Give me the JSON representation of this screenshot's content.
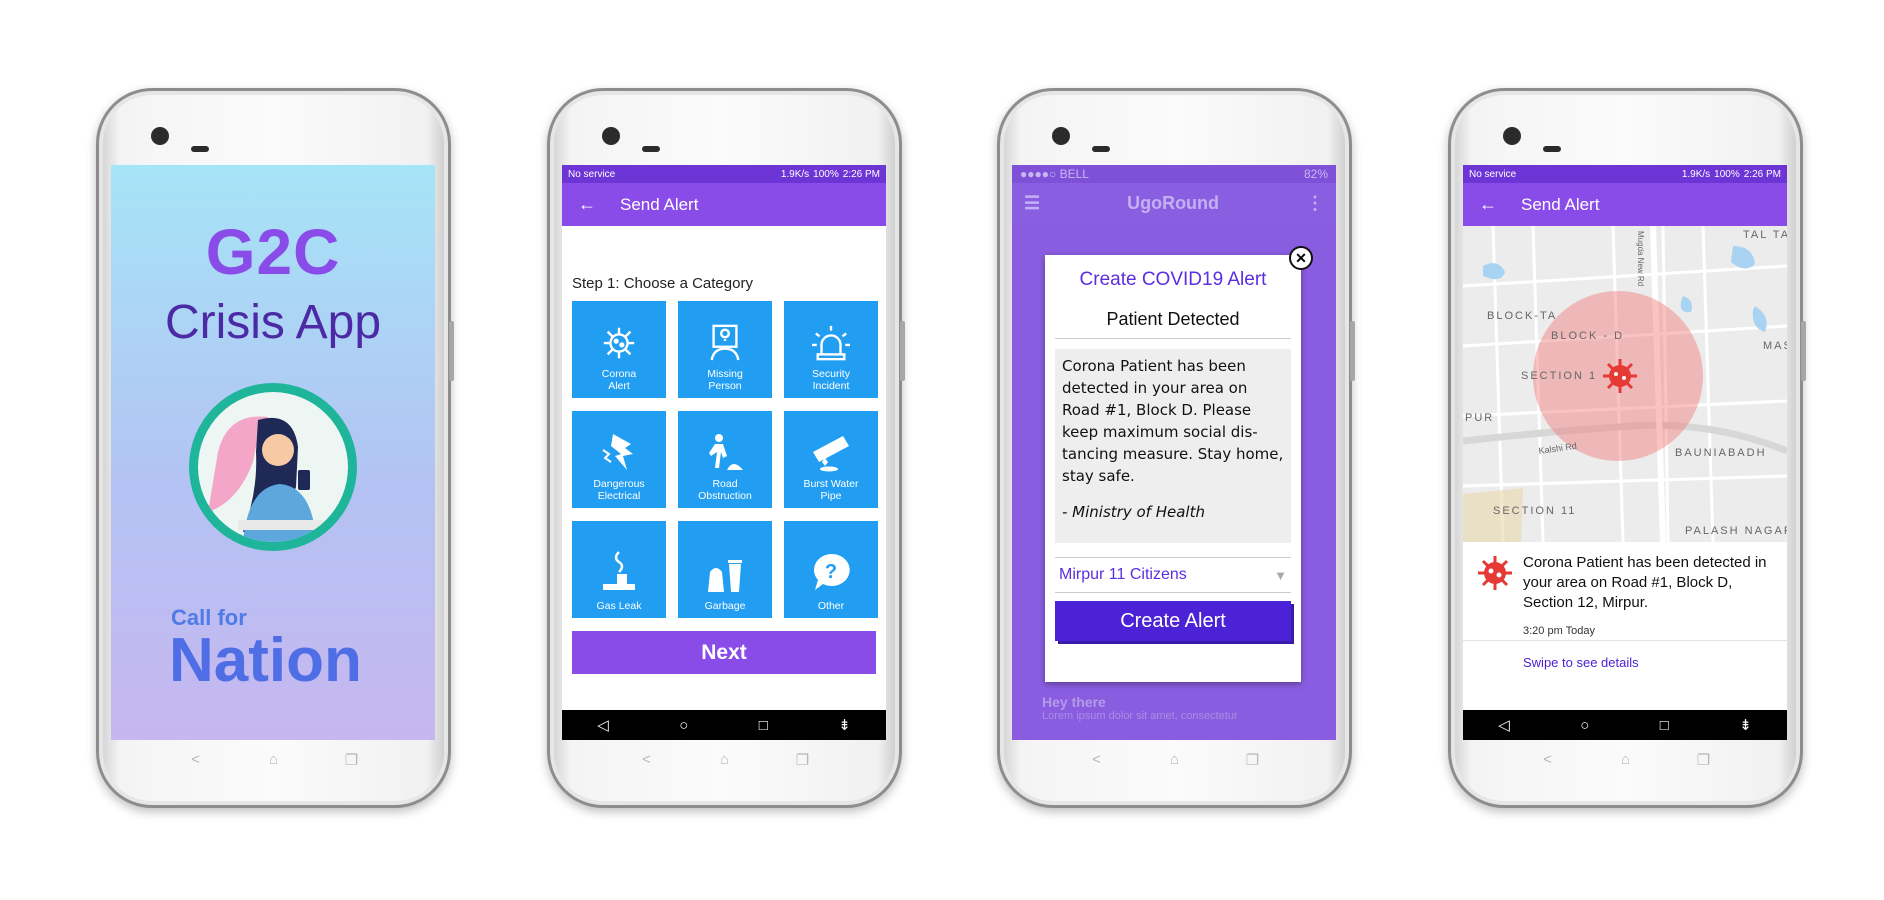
{
  "phone1": {
    "title": "G2C",
    "subtitle": "Crisis App",
    "call_for": "Call for",
    "nation": "Nation"
  },
  "android_status": {
    "left": "No service",
    "right": "1.9K/s",
    "battery": "100%",
    "time": "2:26 PM"
  },
  "phone2": {
    "appbar_title": "Send Alert",
    "step_label": "Step 1: Choose a Category",
    "categories": [
      {
        "line1": "Corona",
        "line2": "Alert",
        "icon": "virus-icon"
      },
      {
        "line1": "Missing",
        "line2": "Person",
        "icon": "missing-person-icon"
      },
      {
        "line1": "Security",
        "line2": "Incident",
        "icon": "siren-icon"
      },
      {
        "line1": "Dangerous",
        "line2": "Electrical",
        "icon": "electric-shock-icon"
      },
      {
        "line1": "Road",
        "line2": "Obstruction",
        "icon": "road-work-icon"
      },
      {
        "line1": "Burst Water",
        "line2": "Pipe",
        "icon": "burst-pipe-icon"
      },
      {
        "line1": "Gas Leak",
        "line2": "",
        "icon": "gas-leak-icon"
      },
      {
        "line1": "Garbage",
        "line2": "",
        "icon": "garbage-icon"
      },
      {
        "line1": "Other",
        "line2": "",
        "icon": "question-icon"
      }
    ],
    "next_label": "Next"
  },
  "phone3": {
    "carrier": "●●●●○ BELL",
    "battery": "82%",
    "app_name": "UgoRound",
    "bg_heading": "Hey there",
    "bg_body": "Lorem ipsum dolor sit amet, consectetur",
    "modal_title": "Create COVID19 Alert",
    "modal_subtitle": "Patient Detected",
    "message": "Corona Patient has been detected in your area on Road #1, Block D. Please keep maximum social dis-tancing measure. Stay home, stay safe.",
    "signature": "- Ministry of Health",
    "audience": "Mirpur 11 Citizens",
    "create_label": "Create Alert"
  },
  "phone4": {
    "appbar_title": "Send Alert",
    "map_labels": {
      "tal_ta": "TAL TA",
      "block_ta": "BLOCK-TA",
      "block_d": "BLOCK - D",
      "section_1": "SECTION 1",
      "mast": "MAST",
      "pur": "PUR",
      "kalshi": "Kalshi Rd",
      "bauniabadh": "BAUNIABADH",
      "section_11": "SECTION 11",
      "palash": "PALASH NAGAR",
      "road": "Mugda New Rd"
    },
    "alert_text": "Corona Patient has been detected in your area on Road #1, Block D, Section 12, Mirpur.",
    "alert_time": "3:20 pm Today",
    "swipe_text": "Swipe to see details"
  },
  "colors": {
    "purple": "#8a4ce8",
    "tile_blue": "#219ef2",
    "alert_red": "#e53935"
  }
}
